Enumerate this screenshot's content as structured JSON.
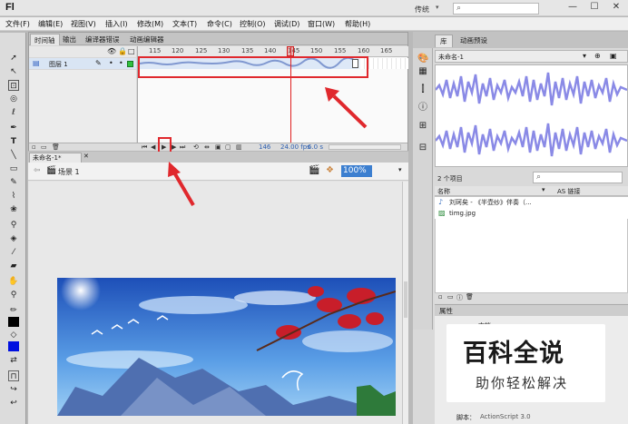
{
  "app": {
    "logo": "Fl",
    "mode": "传统",
    "search_placeholder": ""
  },
  "window_controls": {
    "minimize": "—",
    "restore": "☐",
    "close": "✕"
  },
  "menu": [
    "文件(F)",
    "编辑(E)",
    "视图(V)",
    "插入(I)",
    "修改(M)",
    "文本(T)",
    "命令(C)",
    "控制(O)",
    "调试(D)",
    "窗口(W)",
    "帮助(H)"
  ],
  "timeline": {
    "tabs": [
      "时间轴",
      "输出",
      "编译器错误",
      "动画编辑器"
    ],
    "layer_name": "图层 1",
    "ruler_ticks": [
      "115",
      "120",
      "125",
      "130",
      "135",
      "140",
      "145",
      "150",
      "155",
      "160",
      "165"
    ],
    "footer": {
      "frame": "146",
      "fps": "24.00 fps",
      "time": "6.0 s"
    }
  },
  "document": {
    "tab": "未命名-1*",
    "scene": "场景 1",
    "zoom": "100%"
  },
  "library": {
    "tabs": [
      "库",
      "动画预设"
    ],
    "doc_select": "未命名-1",
    "count": "2 个项目",
    "columns": {
      "name": "名称",
      "linkage": "AS 链接"
    },
    "items": [
      {
        "name": "刘珂矣 - 《半壶纱》伴奏（...",
        "icon": "sound-icon"
      },
      {
        "name": "timg.jpg",
        "icon": "bitmap-icon"
      }
    ]
  },
  "properties": {
    "tab": "属性",
    "doc_label": "文档",
    "script_label": "脚本：",
    "script_value": "ActionScript 3.0"
  },
  "watermark": {
    "title": "百科全说",
    "subtitle": "助你轻松解决"
  }
}
